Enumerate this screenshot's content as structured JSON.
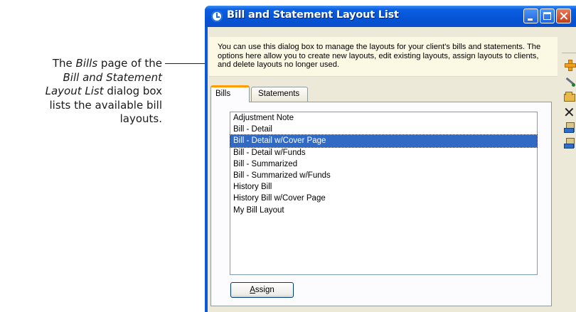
{
  "callout": {
    "line1": "The ",
    "bills_word": "Bills",
    "line1b": " page of the ",
    "dialog_name": "Bill and Statement Layout List",
    "line2": " dialog box lists the available bill layouts."
  },
  "window": {
    "title": "Bill and Statement Layout List"
  },
  "info": {
    "text": "You can use this dialog box to manage the layouts for your client's bills and statements. The options here allow you to create new layouts, edit existing layouts, assign layouts to clients, and delete layouts no longer used."
  },
  "tabs": [
    {
      "label": "Bills",
      "active": true
    },
    {
      "label": "Statements",
      "active": false
    }
  ],
  "layouts": [
    {
      "label": "Adjustment Note"
    },
    {
      "label": "Bill - Detail"
    },
    {
      "label": "Bill - Detail w/Cover Page",
      "selected": true
    },
    {
      "label": "Bill - Detail w/Funds"
    },
    {
      "label": "Bill - Summarized"
    },
    {
      "label": "Bill - Summarized w/Funds"
    },
    {
      "label": "History Bill"
    },
    {
      "label": "History Bill w/Cover Page"
    },
    {
      "label": "My Bill Layout"
    }
  ],
  "buttons": {
    "assign_mnemonic": "A",
    "assign_rest": "ssign"
  },
  "toolbar": {
    "icons": [
      "add-icon",
      "edit-icon",
      "open-folder-icon",
      "delete-icon",
      "assign-icon",
      "unassign-icon"
    ],
    "delete_glyph": "✕"
  },
  "colors": {
    "titlebar": "#0654d6",
    "selection": "#316ac5",
    "active_tab_accent": "#ff9c00",
    "info_background": "#fbf8e4",
    "dialog_background": "#ece9d8"
  }
}
